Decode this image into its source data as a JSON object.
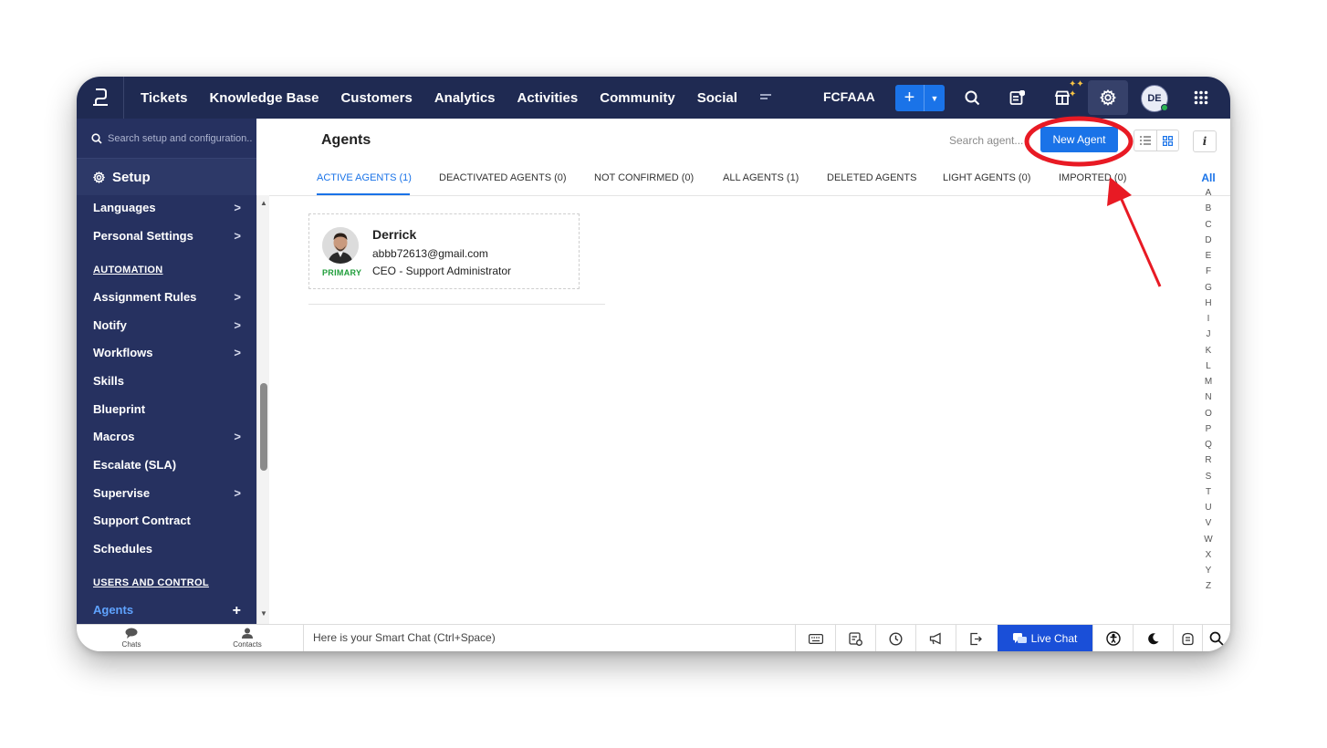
{
  "topbar": {
    "nav": [
      "Tickets",
      "Knowledge Base",
      "Customers",
      "Analytics",
      "Activities",
      "Community",
      "Social"
    ],
    "org_name": "FCFAAA",
    "avatar_initials": "DE"
  },
  "sidebar": {
    "search_placeholder": "Search setup and configuration..",
    "setup_label": "Setup",
    "items": {
      "languages": "Languages",
      "personal_settings": "Personal Settings",
      "automation_head": "AUTOMATION",
      "assignment_rules": "Assignment Rules",
      "notify": "Notify",
      "workflows": "Workflows",
      "skills": "Skills",
      "blueprint": "Blueprint",
      "macros": "Macros",
      "escalate": "Escalate (SLA)",
      "supervise": "Supervise",
      "support_contract": "Support Contract",
      "schedules": "Schedules",
      "users_head": "USERS AND CONTROL",
      "agents": "Agents"
    }
  },
  "main": {
    "title": "Agents",
    "search_placeholder": "Search agent...",
    "new_agent_label": "New Agent",
    "tabs": {
      "active": "ACTIVE AGENTS (1)",
      "deactivated": "DEACTIVATED AGENTS (0)",
      "not_confirmed": "NOT CONFIRMED (0)",
      "all": "ALL AGENTS (1)",
      "deleted": "DELETED AGENTS",
      "light": "LIGHT AGENTS (0)",
      "imported": "IMPORTED (0)"
    },
    "alphabet_all": "All",
    "alphabet": [
      "A",
      "B",
      "C",
      "D",
      "E",
      "F",
      "G",
      "H",
      "I",
      "J",
      "K",
      "L",
      "M",
      "N",
      "O",
      "P",
      "Q",
      "R",
      "S",
      "T",
      "U",
      "V",
      "W",
      "X",
      "Y",
      "Z"
    ],
    "agent": {
      "name": "Derrick",
      "email": "abbb72613@gmail.com",
      "role": "CEO - Support Administrator",
      "badge": "PRIMARY"
    }
  },
  "bottombar": {
    "chats": "Chats",
    "contacts": "Contacts",
    "smart_chat": "Here is your Smart Chat (Ctrl+Space)",
    "live_chat": "Live Chat"
  },
  "colors": {
    "topbar": "#1f2a52",
    "sidebar": "#263160",
    "accent": "#1a73e8",
    "annotation": "#e81a24"
  }
}
